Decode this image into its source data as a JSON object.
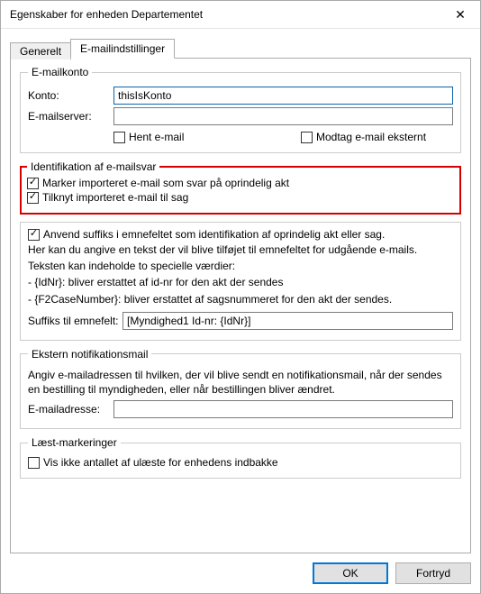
{
  "window": {
    "title": "Egenskaber for enheden Departementet",
    "close": "✕"
  },
  "tabs": {
    "general": "Generelt",
    "email": "E-mailindstillinger"
  },
  "emailAccount": {
    "legend": "E-mailkonto",
    "kontoLabel": "Konto:",
    "kontoValue": "thisIsKonto",
    "serverLabel": "E-mailserver:",
    "serverValue": "",
    "hentEmail": "Hent e-mail",
    "modtagEksternt": "Modtag e-mail eksternt"
  },
  "identGroup": {
    "legend": "Identifikation af e-mailsvar",
    "markImported": "Marker importeret e-mail som svar på oprindelig akt",
    "attachImported": "Tilknyt importeret e-mail til sag"
  },
  "suffixGroup": {
    "useSuffix": "Anvend suffiks i emnefeltet som identifikation af oprindelig akt eller sag.",
    "help1": "Her kan du angive en tekst der vil blive tilføjet til emnefeltet for udgående e-mails.",
    "help2": "Teksten kan indeholde to specielle værdier:",
    "help3": " - {IdNr}: bliver erstattet af id-nr for den akt der sendes",
    "help4": " - {F2CaseNumber}: bliver erstattet af sagsnummeret for den akt der sendes.",
    "suffixLabel": "Suffiks til emnefelt:",
    "suffixValue": "[Myndighed1 Id-nr: {IdNr}]"
  },
  "notifGroup": {
    "legend": "Ekstern notifikationsmail",
    "help": "Angiv e-mailadressen til hvilken, der vil blive sendt en notifikationsmail, når der sendes en bestilling til myndigheden, eller når bestillingen bliver ændret.",
    "emailLabel": "E-mailadresse:",
    "emailValue": ""
  },
  "readGroup": {
    "legend": "Læst-markeringer",
    "hideUnread": "Vis ikke antallet af ulæste for enhedens indbakke"
  },
  "buttons": {
    "ok": "OK",
    "cancel": "Fortryd"
  }
}
